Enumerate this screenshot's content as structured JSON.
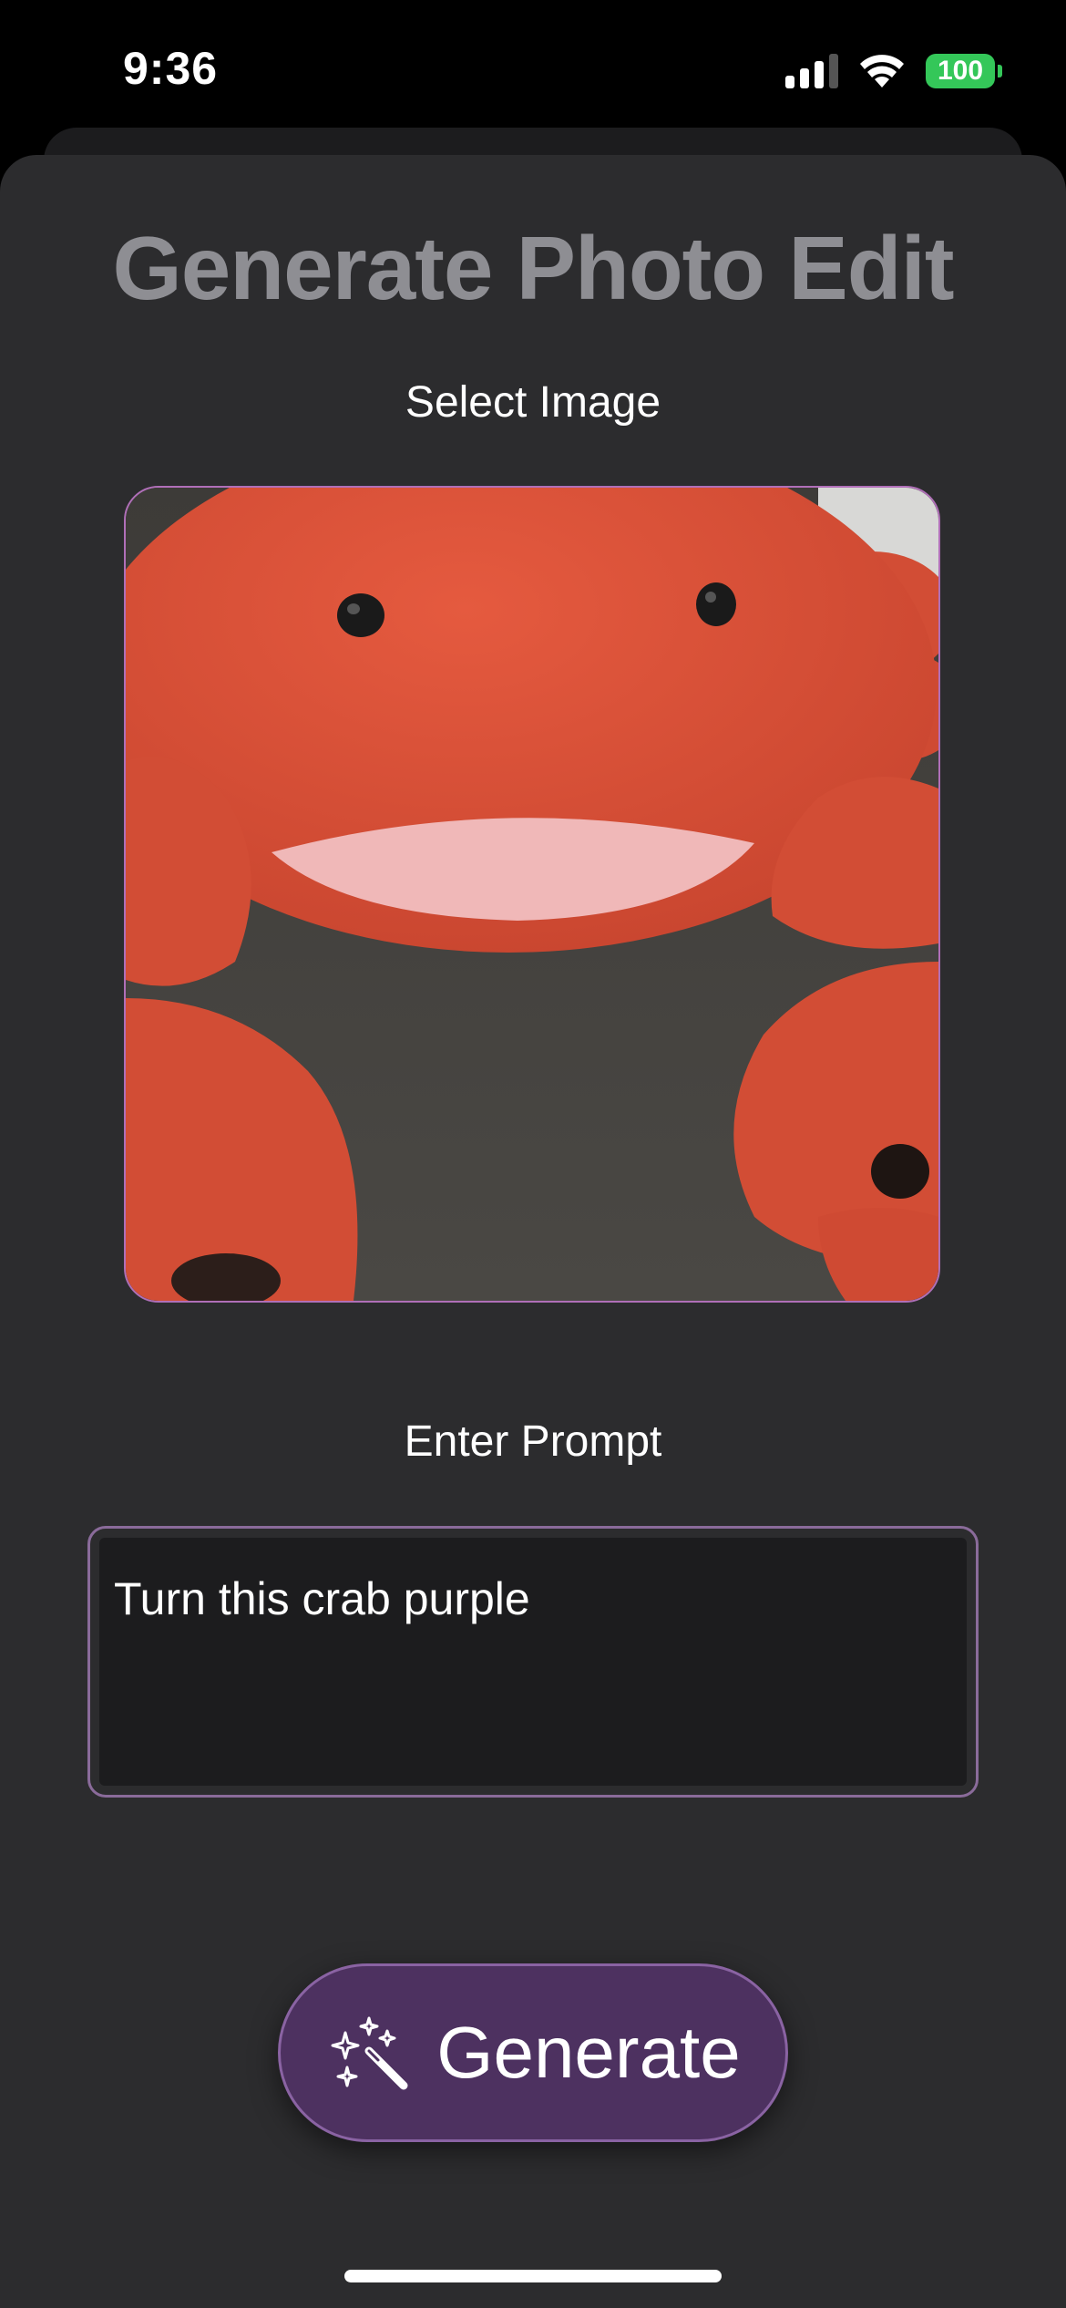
{
  "status_bar": {
    "time": "9:36",
    "battery": "100",
    "signal_icon": "cellular-signal-icon",
    "wifi_icon": "wifi-icon"
  },
  "header": {
    "title": "Generate Photo Edit"
  },
  "image_section": {
    "label": "Select Image",
    "image_alt": "Photo of a red plush crab toy"
  },
  "prompt_section": {
    "label": "Enter Prompt",
    "value": "Turn this crab purple"
  },
  "generate_button": {
    "label": "Generate",
    "icon": "magic-wand-sparkles-icon"
  },
  "colors": {
    "accent": "#4d3160",
    "accent_border": "#8a63a3",
    "sheet_background": "#2c2c2e",
    "title": "#8e8e93",
    "battery": "#34c759"
  }
}
